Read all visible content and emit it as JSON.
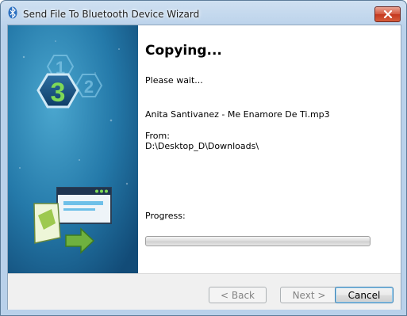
{
  "window": {
    "title": "Send File To Bluetooth Device Wizard"
  },
  "sidebar": {
    "steps": [
      "1",
      "2",
      "3"
    ],
    "current_step": "3"
  },
  "main": {
    "heading": "Copying...",
    "status": "Please wait...",
    "file_name": "Anita Santivanez - Me Enamore De Ti.mp3",
    "from_label": "From:",
    "from_path": "D:\\Desktop_D\\Downloads\\",
    "progress_label": "Progress:",
    "progress_value": 0
  },
  "buttons": {
    "back": "< Back",
    "next": "Next >",
    "cancel": "Cancel"
  },
  "colors": {
    "sidebar_dark": "#14507a",
    "sidebar_light": "#3a9ac4",
    "accent_green": "#7ed957"
  }
}
